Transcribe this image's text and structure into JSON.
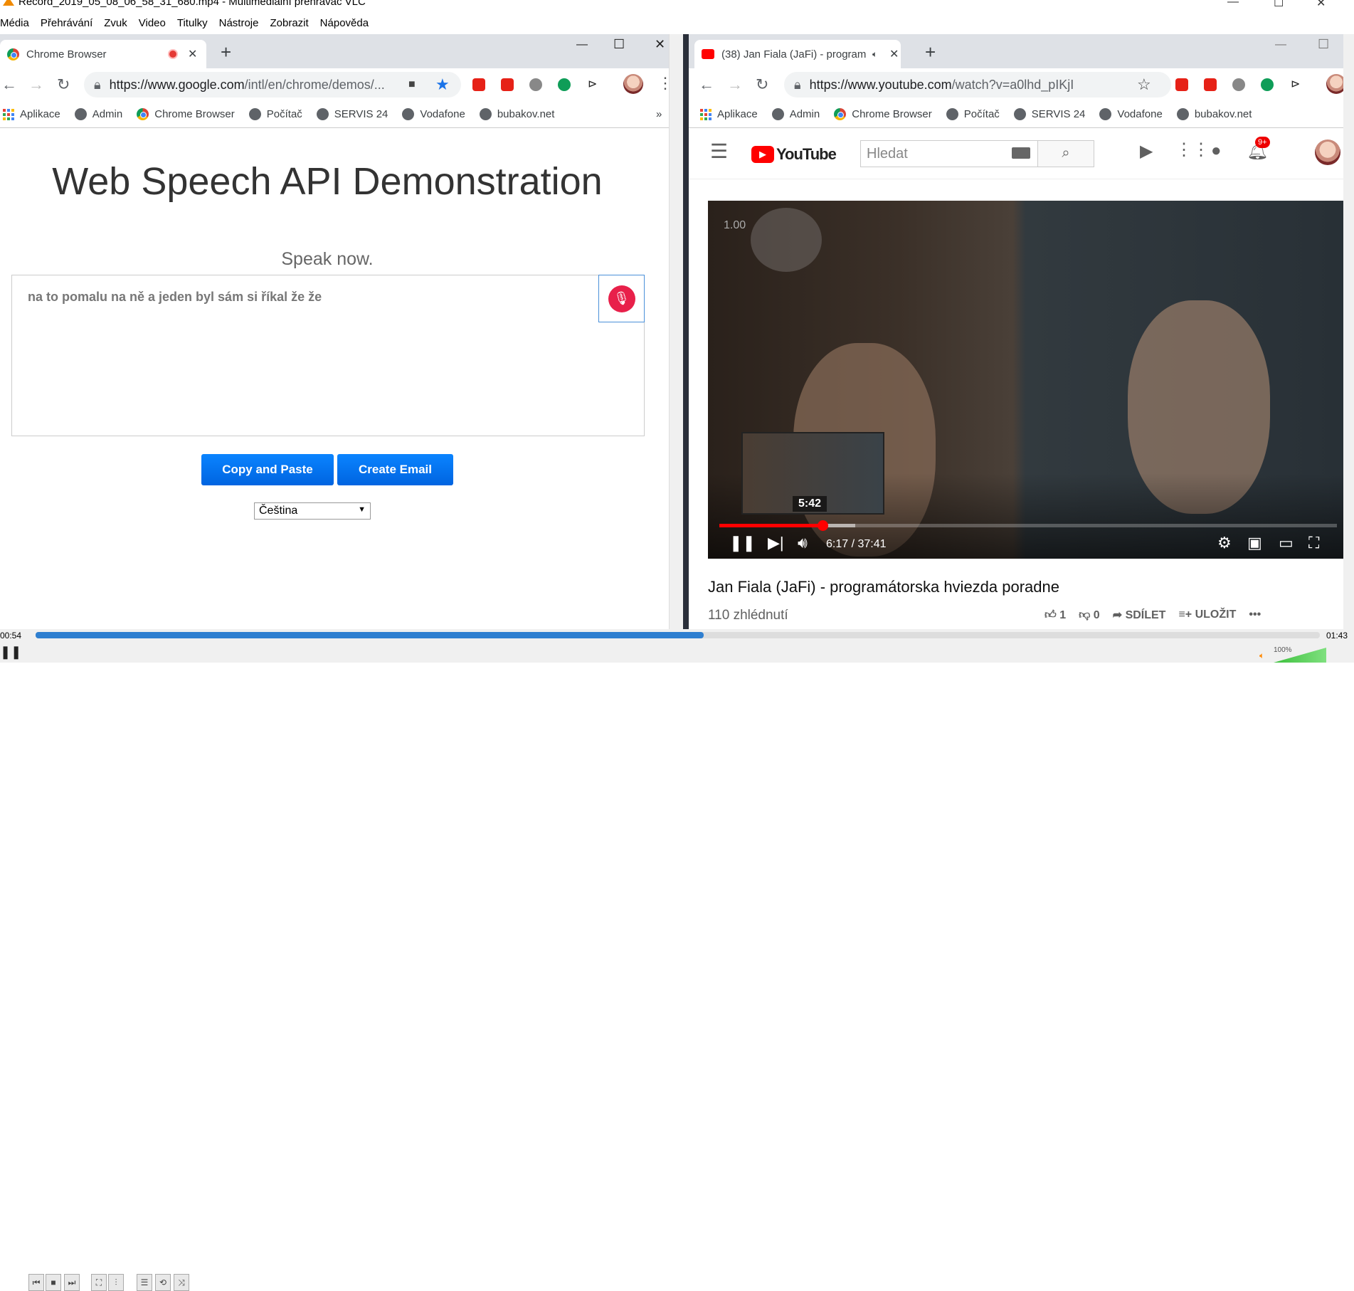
{
  "vlc": {
    "title": "Record_2019_05_08_06_58_31_680.mp4 - Multimediální přehrávač VLC",
    "menu": [
      "Média",
      "Přehrávání",
      "Zvuk",
      "Video",
      "Titulky",
      "Nástroje",
      "Zobrazit",
      "Nápověda"
    ],
    "elapsed": "00:54",
    "total": "01:43",
    "progress": 0.52,
    "volume": "100%"
  },
  "left": {
    "tab_title": "Chrome Browser",
    "url_host": "https://www.google.com",
    "url_path": "/intl/en/chrome/demos/...",
    "bookmarks": [
      "Aplikace",
      "Admin",
      "Chrome Browser",
      "Počítač",
      "SERVIS 24",
      "Vodafone",
      "bubakov.net"
    ],
    "more": "»",
    "page": {
      "title": "Web Speech API Demonstration",
      "status": "Speak now.",
      "transcript": "na to pomalu na ně a jeden byl sám si říkal že že",
      "copy_button": "Copy and Paste",
      "email_button": "Create Email",
      "language": "Čeština"
    }
  },
  "right": {
    "tab_title": "(38) Jan Fiala (JaFi) - program",
    "url_host": "https://www.youtube.com",
    "url_path": "/watch?v=a0lhd_pIKjI",
    "bookmarks": [
      "Aplikace",
      "Admin",
      "Chrome Browser",
      "Počítač",
      "SERVIS 24",
      "Vodafone",
      "bubakov.net"
    ],
    "youtube": {
      "logo": "YouTube",
      "search_placeholder": "Hledat",
      "notifications": "9+",
      "video": {
        "overlay": "1.00",
        "preview_time": "5:42",
        "time": "6:17 / 37:41",
        "progress": 0.167,
        "buffered": 0.22
      },
      "title": "Jan Fiala (JaFi) - programátorska hviezda poradne",
      "views": "110 zhlédnutí",
      "likes": "1",
      "dislikes": "0",
      "share": "SDÍLET",
      "save": "ULOŽIT"
    }
  },
  "colors": {
    "accent_blue": "#0a84ff",
    "yt_red": "#ff0000",
    "vlc_progress": "#2f7fd0"
  }
}
